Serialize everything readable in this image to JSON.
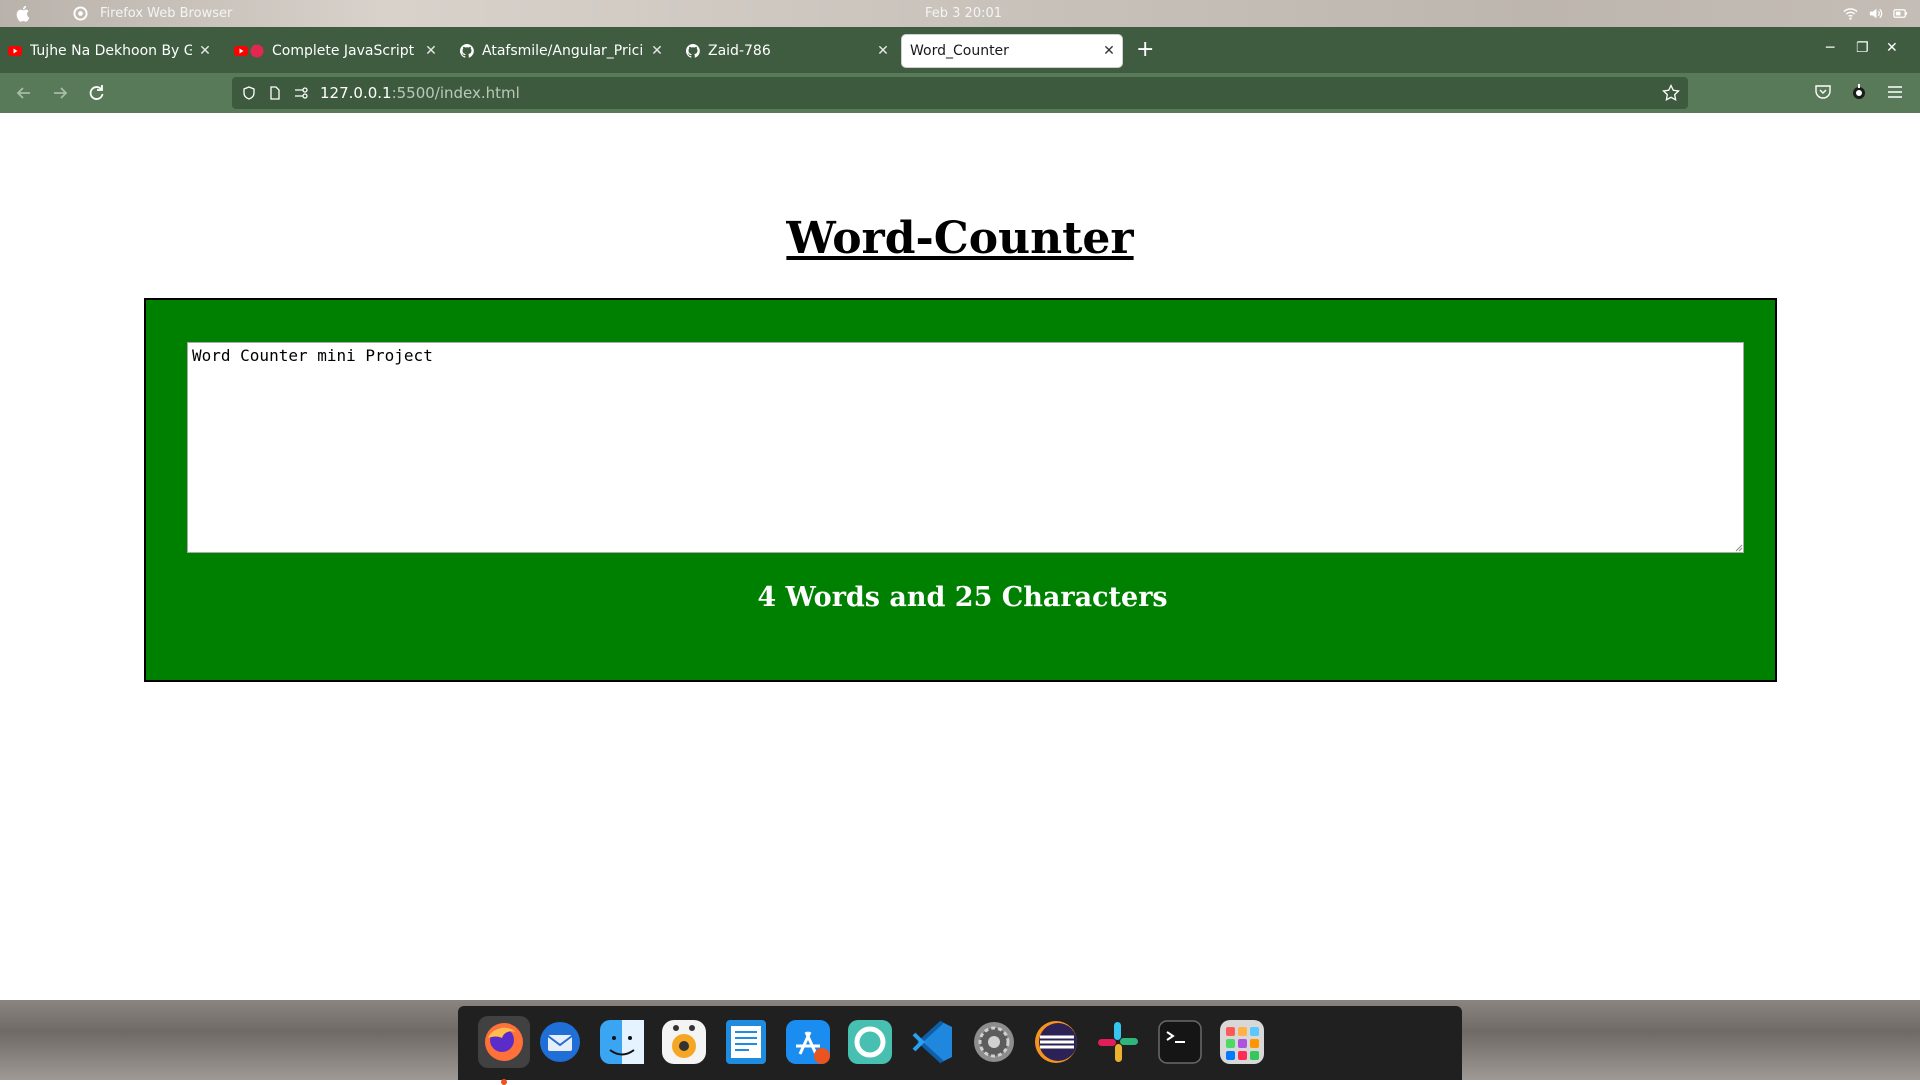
{
  "os_bar": {
    "app_name": "Firefox Web Browser",
    "clock": "Feb 3  20:01"
  },
  "tabs": [
    {
      "title": "Tujhe Na Dekhoon By Ge",
      "favicon": "youtube-icon"
    },
    {
      "title": "Complete JavaScript T",
      "favicon": "youtube-icon"
    },
    {
      "title": "Atafsmile/Angular_Pricin",
      "favicon": "github-icon"
    },
    {
      "title": "Zaid-786",
      "favicon": "github-icon"
    },
    {
      "title": "Word_Counter",
      "favicon": "none",
      "active": true
    }
  ],
  "new_tab_label": "+",
  "address": {
    "host": "127.0.0.1",
    "rest": ":5500/index.html"
  },
  "page": {
    "title": "Word-Counter",
    "textarea_value": "Word Counter mini Project",
    "result_text": "4 Words and 25 Characters"
  },
  "colors": {
    "panel_bg": "#008000",
    "tabstrip_bg": "#3f5c40",
    "navbar_bg": "#587a58"
  },
  "dock": {
    "items": [
      "firefox-icon",
      "thunderbird-icon",
      "finder-icon",
      "rhythmbox-icon",
      "writer-icon",
      "app-store-icon",
      "help-icon",
      "vscode-icon",
      "settings-icon",
      "eclipse-icon",
      "slack-icon",
      "terminal-icon",
      "app-grid-icon"
    ]
  }
}
